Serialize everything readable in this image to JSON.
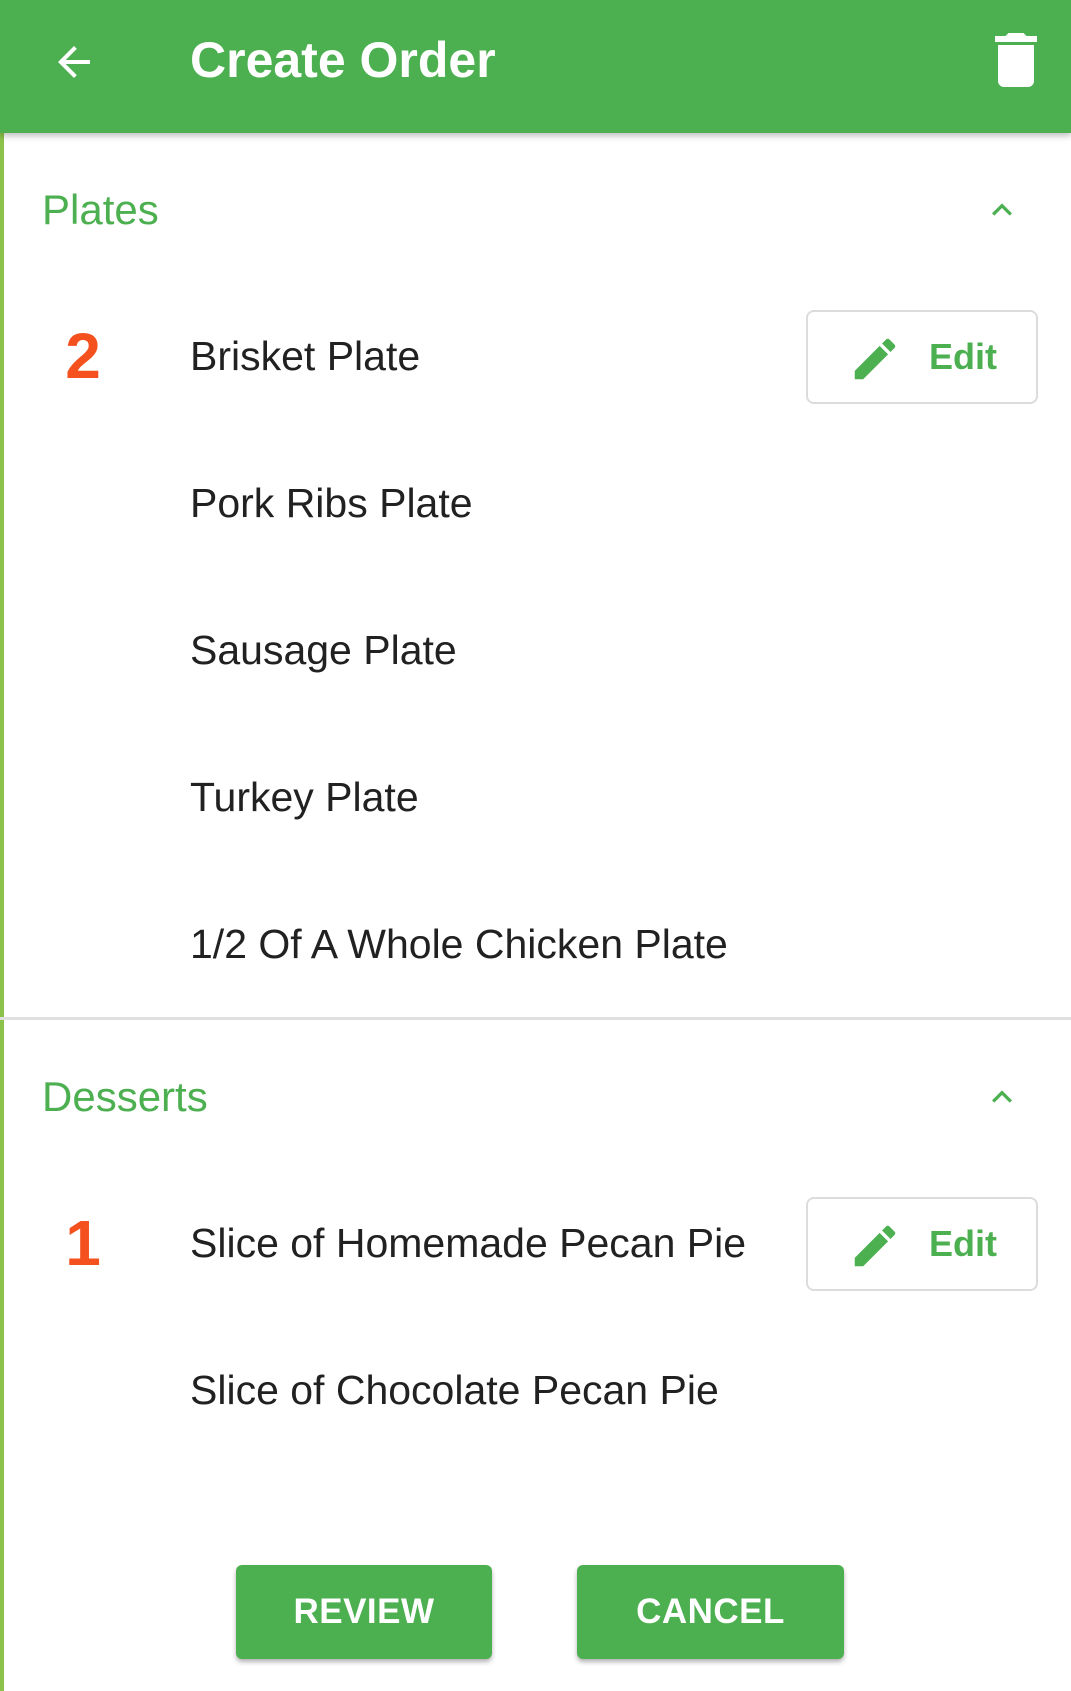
{
  "appbar": {
    "title": "Create Order",
    "back_icon": "arrow-left-icon",
    "trash_icon": "trash-icon",
    "color": "#4CAF50"
  },
  "sections": [
    {
      "title": "Plates",
      "items": [
        {
          "qty": "2",
          "name": "Brisket Plate",
          "edit_label": "Edit"
        },
        {
          "qty": "",
          "name": "Pork Ribs Plate"
        },
        {
          "qty": "",
          "name": "Sausage Plate"
        },
        {
          "qty": "",
          "name": "Turkey Plate"
        },
        {
          "qty": "",
          "name": "1/2 Of A Whole Chicken Plate"
        }
      ]
    },
    {
      "title": "Desserts",
      "items": [
        {
          "qty": "1",
          "name": "Slice of Homemade Pecan Pie",
          "edit_label": "Edit"
        },
        {
          "qty": "",
          "name": "Slice of Chocolate Pecan Pie"
        }
      ]
    }
  ],
  "actions": {
    "review_label": "REVIEW",
    "cancel_label": "CANCEL"
  },
  "colors": {
    "accent": "#4CAF50",
    "quantity": "#F4511E",
    "text": "#212121"
  }
}
